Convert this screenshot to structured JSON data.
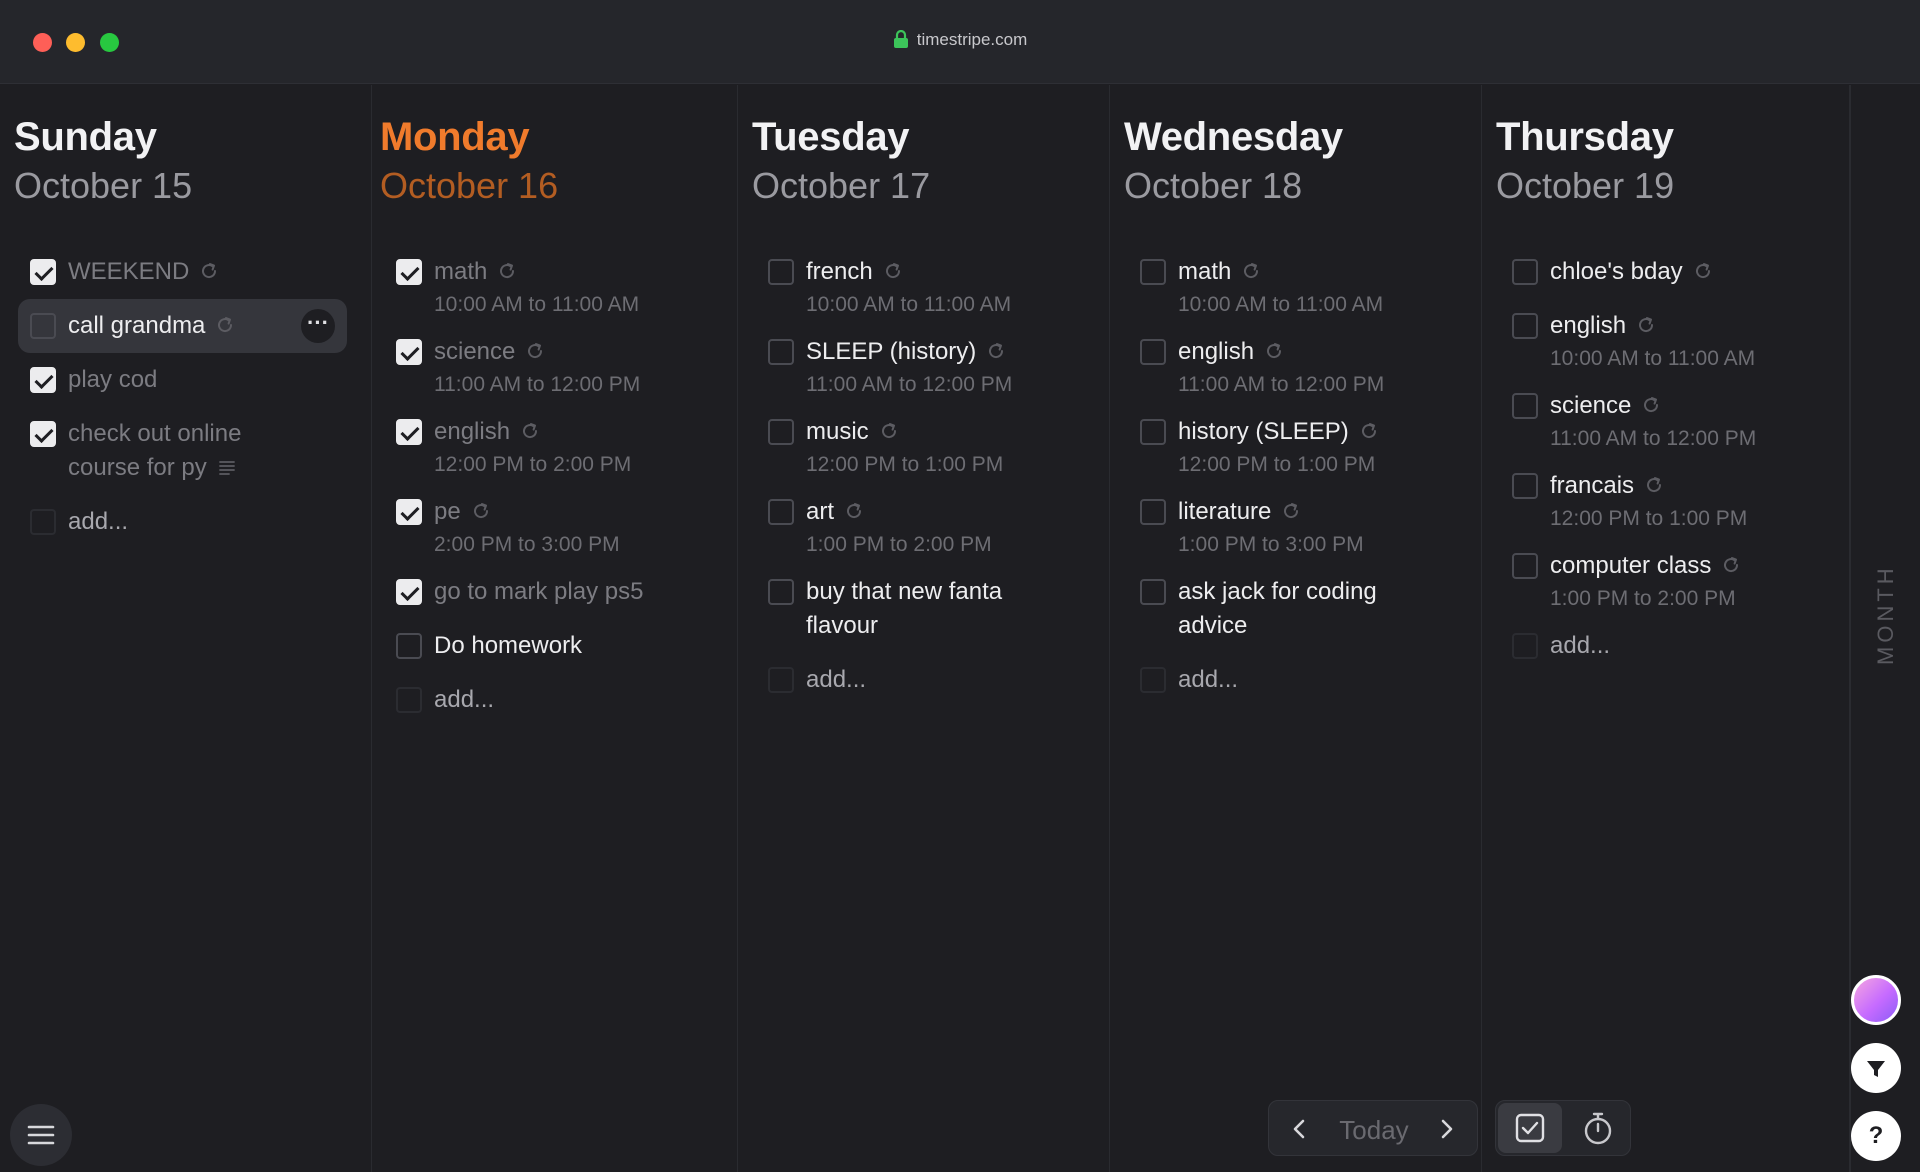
{
  "browser": {
    "url": "timestripe.com"
  },
  "days": [
    {
      "name": "Sunday",
      "date": "October 15",
      "today": false,
      "tasks": [
        {
          "label": "WEEKEND",
          "time": "",
          "checked": true,
          "repeat": true,
          "notes": false,
          "highlight": false,
          "lines": []
        },
        {
          "label": "call grandma",
          "time": "",
          "checked": false,
          "repeat": true,
          "notes": false,
          "highlight": true,
          "lines": []
        },
        {
          "label": "play cod",
          "time": "",
          "checked": true,
          "repeat": false,
          "notes": false,
          "highlight": false,
          "lines": []
        },
        {
          "label": "",
          "time": "",
          "checked": true,
          "repeat": false,
          "notes": true,
          "highlight": false,
          "lines": [
            "check out online",
            "course for py"
          ]
        }
      ],
      "add_label": "add..."
    },
    {
      "name": "Monday",
      "date": "October 16",
      "today": true,
      "tasks": [
        {
          "label": "math",
          "time": "10:00 AM to 11:00 AM",
          "checked": true,
          "repeat": true,
          "notes": false,
          "highlight": false,
          "lines": []
        },
        {
          "label": "science",
          "time": "11:00 AM to 12:00 PM",
          "checked": true,
          "repeat": true,
          "notes": false,
          "highlight": false,
          "lines": []
        },
        {
          "label": "english",
          "time": "12:00 PM to 2:00 PM",
          "checked": true,
          "repeat": true,
          "notes": false,
          "highlight": false,
          "lines": []
        },
        {
          "label": "pe",
          "time": "2:00 PM to 3:00 PM",
          "checked": true,
          "repeat": true,
          "notes": false,
          "highlight": false,
          "lines": []
        },
        {
          "label": "go to mark play ps5",
          "time": "",
          "checked": true,
          "repeat": false,
          "notes": false,
          "highlight": false,
          "lines": []
        },
        {
          "label": "Do homework",
          "time": "",
          "checked": false,
          "repeat": false,
          "notes": false,
          "highlight": false,
          "lines": []
        }
      ],
      "add_label": "add..."
    },
    {
      "name": "Tuesday",
      "date": "October 17",
      "today": false,
      "tasks": [
        {
          "label": "french",
          "time": "10:00 AM to 11:00 AM",
          "checked": false,
          "repeat": true,
          "notes": false,
          "highlight": false,
          "lines": []
        },
        {
          "label": "SLEEP (history)",
          "time": "11:00 AM to 12:00 PM",
          "checked": false,
          "repeat": true,
          "notes": false,
          "highlight": false,
          "lines": []
        },
        {
          "label": "music",
          "time": "12:00 PM to 1:00 PM",
          "checked": false,
          "repeat": true,
          "notes": false,
          "highlight": false,
          "lines": []
        },
        {
          "label": "art",
          "time": "1:00 PM to 2:00 PM",
          "checked": false,
          "repeat": true,
          "notes": false,
          "highlight": false,
          "lines": []
        },
        {
          "label": "",
          "time": "",
          "checked": false,
          "repeat": false,
          "notes": false,
          "highlight": false,
          "lines": [
            "buy that new fanta",
            "flavour"
          ]
        }
      ],
      "add_label": "add..."
    },
    {
      "name": "Wednesday",
      "date": "October 18",
      "today": false,
      "tasks": [
        {
          "label": "math",
          "time": "10:00 AM to 11:00 AM",
          "checked": false,
          "repeat": true,
          "notes": false,
          "highlight": false,
          "lines": []
        },
        {
          "label": "english",
          "time": "11:00 AM to 12:00 PM",
          "checked": false,
          "repeat": true,
          "notes": false,
          "highlight": false,
          "lines": []
        },
        {
          "label": "history (SLEEP)",
          "time": "12:00 PM to 1:00 PM",
          "checked": false,
          "repeat": true,
          "notes": false,
          "highlight": false,
          "lines": []
        },
        {
          "label": "literature",
          "time": "1:00 PM to 3:00 PM",
          "checked": false,
          "repeat": true,
          "notes": false,
          "highlight": false,
          "lines": []
        },
        {
          "label": "",
          "time": "",
          "checked": false,
          "repeat": false,
          "notes": false,
          "highlight": false,
          "lines": [
            "ask jack for coding",
            "advice"
          ]
        }
      ],
      "add_label": "add..."
    },
    {
      "name": "Thursday",
      "date": "October 19",
      "today": false,
      "tasks": [
        {
          "label": "chloe's bday",
          "time": "",
          "checked": false,
          "repeat": true,
          "notes": false,
          "highlight": false,
          "lines": []
        },
        {
          "label": "english",
          "time": "10:00 AM to 11:00 AM",
          "checked": false,
          "repeat": true,
          "notes": false,
          "highlight": false,
          "lines": []
        },
        {
          "label": "science",
          "time": "11:00 AM to 12:00 PM",
          "checked": false,
          "repeat": true,
          "notes": false,
          "highlight": false,
          "lines": []
        },
        {
          "label": "francais",
          "time": "12:00 PM to 1:00 PM",
          "checked": false,
          "repeat": true,
          "notes": false,
          "highlight": false,
          "lines": []
        },
        {
          "label": "computer class",
          "time": "1:00 PM to 2:00 PM",
          "checked": false,
          "repeat": true,
          "notes": false,
          "highlight": false,
          "lines": []
        }
      ],
      "add_label": "add..."
    }
  ],
  "side": {
    "month_label": "MONTH",
    "help_label": "?"
  },
  "nav": {
    "today_label": "Today"
  },
  "icons": {
    "lock": "lock-icon",
    "repeat": "repeat-icon",
    "notes": "notes-icon",
    "more": "more-icon",
    "menu": "hamburger-menu-icon",
    "prev": "chevron-left-icon",
    "next": "chevron-right-icon",
    "tasks_mode": "checkbox-icon",
    "timer_mode": "stopwatch-icon",
    "filter": "filter-icon"
  },
  "colors": {
    "accent_today": "#f07b2c",
    "background": "#1e1e22"
  }
}
